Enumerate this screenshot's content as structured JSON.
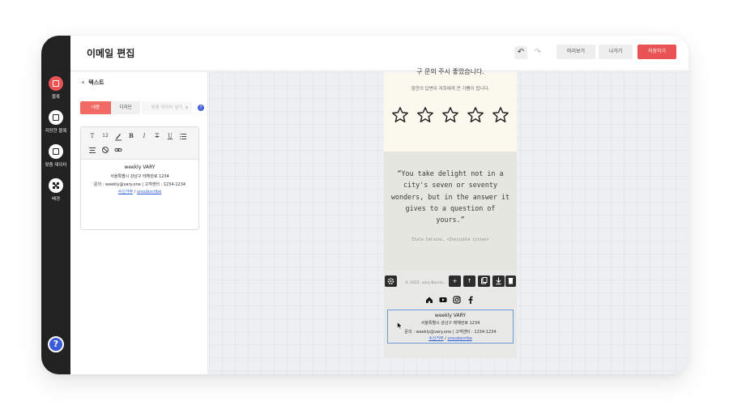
{
  "sidebar": {
    "items": [
      {
        "label": "블록",
        "icon": "block-icon",
        "active": true
      },
      {
        "label": "저장한 블록",
        "icon": "saved-block-icon",
        "active": false
      },
      {
        "label": "맞춤 데이터",
        "icon": "custom-data-icon",
        "active": false
      },
      {
        "label": "배경",
        "icon": "background-icon",
        "active": false
      }
    ],
    "help_label": "?"
  },
  "topbar": {
    "title": "이메일 편집",
    "undo": "↶",
    "redo": "↷",
    "preview_label": "미리보기",
    "exit_label": "나가기",
    "save_label": "저장하기"
  },
  "panel": {
    "back_label": "텍스트",
    "tabs": {
      "content": "내용",
      "design": "디자인",
      "custom": "맞춤 데이터 넣기"
    },
    "toolbar": {
      "text": "T",
      "size": "12",
      "bold": "B",
      "italic": "I",
      "strike": "T",
      "underline": "U"
    },
    "editor": {
      "name": "weekly VARY",
      "address": "서울특별시 강남구 테헤란로 1234",
      "contact": "문의 : weekly@vary.one  |  고객센터 : 1234-1234",
      "link_1": "수신거부",
      "sep": " / ",
      "link_2": "unsubscribe"
    }
  },
  "email": {
    "rating_top": "구 문의 주시 좋았습니다.",
    "rating_text": "잠깐의 답변이 저희에게 큰 기쁨이 됩니다.",
    "quote": "“You take delight not in a city's seven or seventy wonders, but in the answer it gives to a question of yours.”",
    "quote_source": "Italo Calvino, <Invisible cities>",
    "copyright": "© 2022. vary Borsin...",
    "footer": {
      "name": "weekly VARY",
      "address": "서울특별시 강남구 테헤란로 1234",
      "contact": "문의 : weekly@vary.one  |  고객센터 : 1234-1234",
      "link_1": "수신거부",
      "sep": " / ",
      "link_2": "unsubscribe"
    }
  },
  "colors": {
    "accent": "#e95353",
    "rail": "#222222",
    "help": "#3d5bd9",
    "selection": "#6f9cd7"
  }
}
